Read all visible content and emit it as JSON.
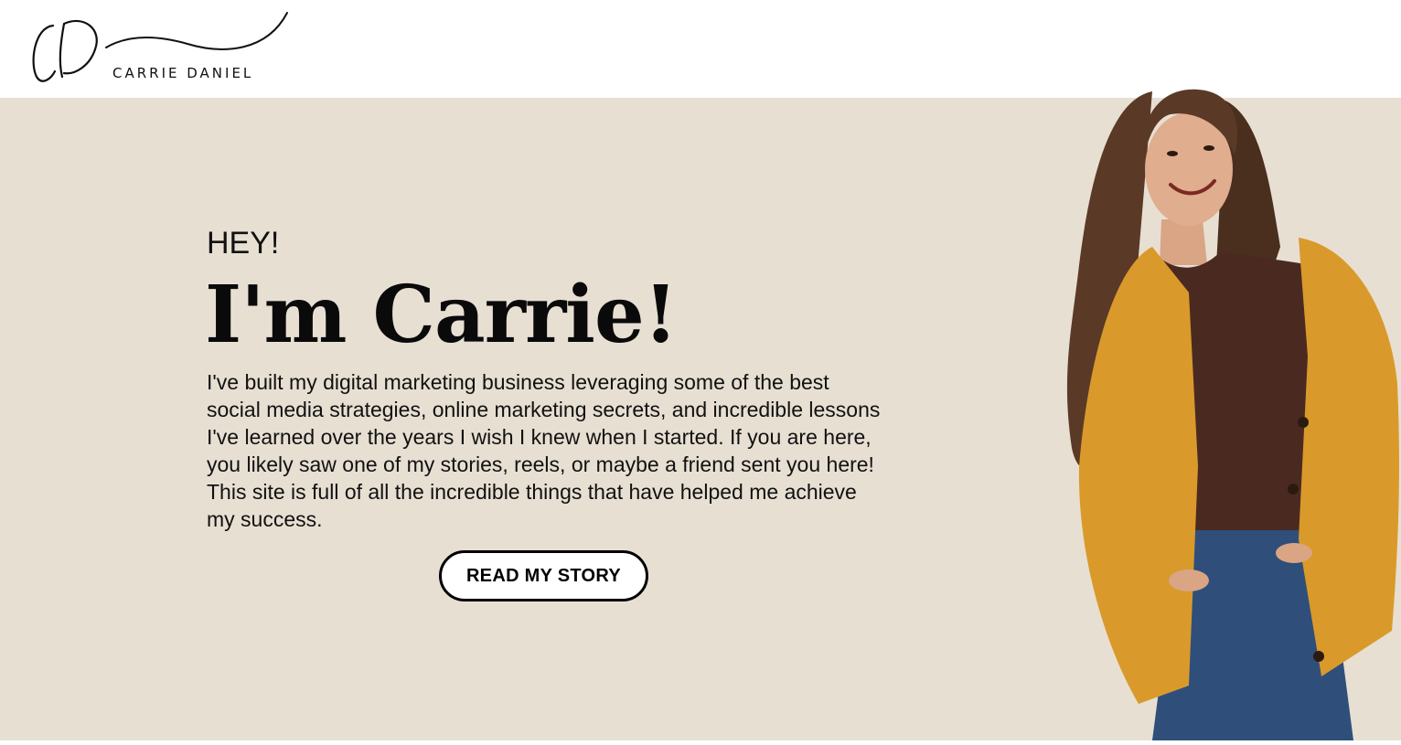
{
  "brand": {
    "monogram": "CD",
    "name": "CARRIE DANIEL"
  },
  "hero": {
    "greeting": "HEY!",
    "title": "I'm Carrie!",
    "intro": "I've built my digital marketing business leveraging some of the best social media strategies, online marketing secrets, and incredible lessons I've learned over the years I wish I knew when I started. If you are here, you likely saw one of my stories, reels, or maybe a friend sent you here! This site is full of all the incredible things that have helped me achieve my success.",
    "cta_label": "READ MY STORY"
  },
  "colors": {
    "header_bg": "#ffffff",
    "hero_bg": "#e7dfd2",
    "text": "#111111",
    "cardigan": "#d99a2b",
    "shirt": "#4a2a20",
    "jeans": "#2f4f7a",
    "hair": "#5a3a26"
  }
}
